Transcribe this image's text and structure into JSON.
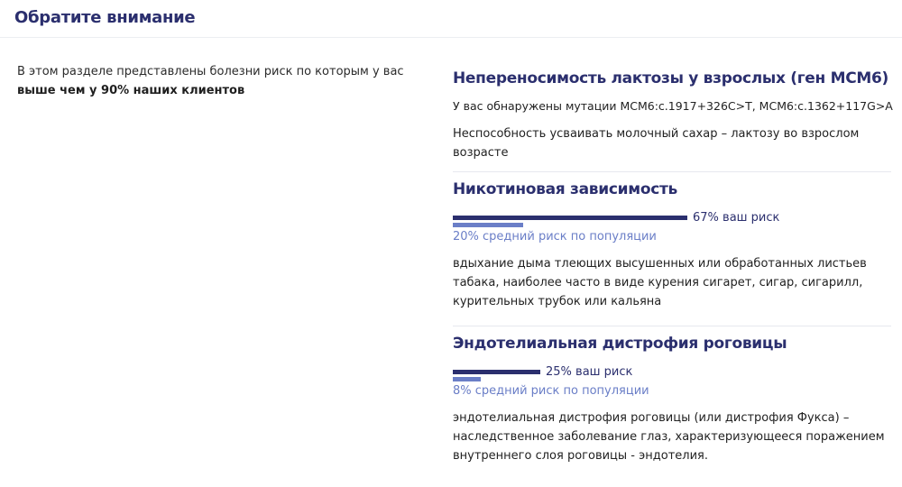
{
  "header": {
    "title": "Обратите внимание"
  },
  "intro": {
    "text": "В этом разделе представлены болезни риск по которым у вас ",
    "bold": "выше чем у 90% наших клиентов"
  },
  "colors": {
    "title": "#2b2f6e",
    "your_risk_bar": "#2b2f6e",
    "population_bar": "#6a7ec7"
  },
  "conditions": [
    {
      "title": "Непереносимость лактозы у взрослых (ген MCM6)",
      "mutations": "У вас обнаружены мутации MCM6:c.1917+326C>T, MCM6:c.1362+117G>A",
      "description": "Неспособность усваивать молочный сахар – лактозу во взрослом возрасте"
    },
    {
      "title": "Никотиновая зависимость",
      "your_risk": 0.67,
      "your_risk_label": "67% ваш риск",
      "population_risk": 0.2,
      "population_risk_label": "20% средний риск по популяции",
      "description": "вдыхание дыма тлеющих высушенных или обработанных листьев табака, наиболее часто в виде курения сигарет, сигар, сигарилл, курительных трубок или кальяна"
    },
    {
      "title": "Эндотелиальная дистрофия роговицы",
      "your_risk": 0.25,
      "your_risk_label": "25% ваш риск",
      "population_risk": 0.08,
      "population_risk_label": "8% средний риск по популяции",
      "description": "эндотелиальная дистрофия роговицы (или дистрофия Фукса) – наследственное заболевание глаз, характеризующееся поражением внутреннего слоя роговицы - эндотелия."
    }
  ]
}
